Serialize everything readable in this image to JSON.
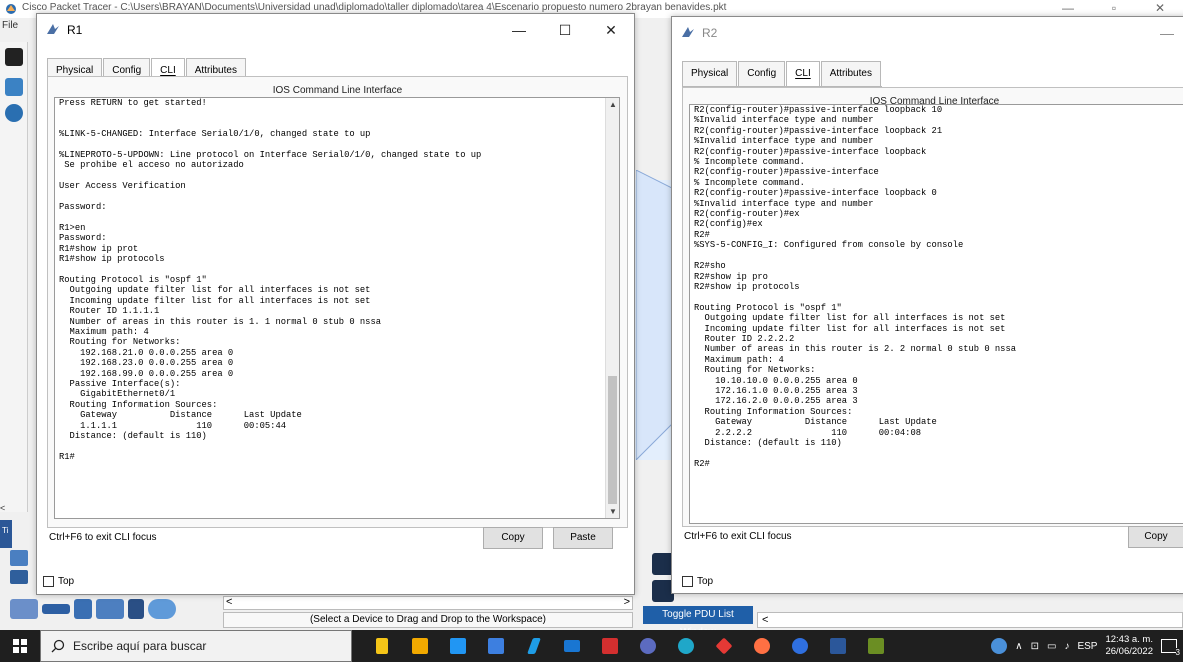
{
  "background_app": {
    "title": "Cisco Packet Tracer - C:\\Users\\BRAYAN\\Documents\\Universidad unad\\diplomado\\taller diplomado\\tarea 4\\Escenario propuesto numero 2brayan benavides.pkt",
    "menu_file": "File",
    "status_text": "(Select a Device to Drag and Drop to the Workspace)",
    "pdu_button": "Toggle PDU List Window",
    "left_strip_label": "Ti"
  },
  "r1_window": {
    "title": "R1",
    "tabs": [
      "Physical",
      "Config",
      "CLI",
      "Attributes"
    ],
    "active_tab": "CLI",
    "header": "IOS Command Line Interface",
    "terminal_lines": [
      "Press RETURN to get started!",
      "",
      "",
      "%LINK-5-CHANGED: Interface Serial0/1/0, changed state to up",
      "",
      "%LINEPROTO-5-UPDOWN: Line protocol on Interface Serial0/1/0, changed state to up",
      " Se prohibe el acceso no autorizado",
      "",
      "User Access Verification",
      "",
      "Password:",
      "",
      "R1>en",
      "Password:",
      "R1#show ip prot",
      "R1#show ip protocols",
      "",
      "Routing Protocol is \"ospf 1\"",
      "  Outgoing update filter list for all interfaces is not set",
      "  Incoming update filter list for all interfaces is not set",
      "  Router ID 1.1.1.1",
      "  Number of areas in this router is 1. 1 normal 0 stub 0 nssa",
      "  Maximum path: 4",
      "  Routing for Networks:",
      "    192.168.21.0 0.0.0.255 area 0",
      "    192.168.23.0 0.0.0.255 area 0",
      "    192.168.99.0 0.0.0.255 area 0",
      "  Passive Interface(s):",
      "    GigabitEthernet0/1",
      "  Routing Information Sources:",
      "    Gateway          Distance      Last Update",
      "    1.1.1.1               110      00:05:44",
      "  Distance: (default is 110)",
      "",
      "R1#"
    ],
    "focus_hint": "Ctrl+F6 to exit CLI focus",
    "copy_label": "Copy",
    "paste_label": "Paste",
    "top_label": "Top"
  },
  "r2_window": {
    "title": "R2",
    "tabs": [
      "Physical",
      "Config",
      "CLI",
      "Attributes"
    ],
    "active_tab": "CLI",
    "header": "IOS Command Line Interface",
    "terminal_lines": [
      "R2(config-router)#passive-interface loopback 10",
      "%Invalid interface type and number",
      "R2(config-router)#passive-interface loopback 21",
      "%Invalid interface type and number",
      "R2(config-router)#passive-interface loopback",
      "% Incomplete command.",
      "R2(config-router)#passive-interface",
      "% Incomplete command.",
      "R2(config-router)#passive-interface loopback 0",
      "%Invalid interface type and number",
      "R2(config-router)#ex",
      "R2(config)#ex",
      "R2#",
      "%SYS-5-CONFIG_I: Configured from console by console",
      "",
      "R2#sho",
      "R2#show ip pro",
      "R2#show ip protocols",
      "",
      "Routing Protocol is \"ospf 1\"",
      "  Outgoing update filter list for all interfaces is not set",
      "  Incoming update filter list for all interfaces is not set",
      "  Router ID 2.2.2.2",
      "  Number of areas in this router is 2. 2 normal 0 stub 0 nssa",
      "  Maximum path: 4",
      "  Routing for Networks:",
      "    10.10.10.0 0.0.0.255 area 0",
      "    172.16.1.0 0.0.0.255 area 3",
      "    172.16.2.0 0.0.0.255 area 3",
      "  Routing Information Sources:",
      "    Gateway          Distance      Last Update",
      "    2.2.2.2               110      00:04:08",
      "  Distance: (default is 110)",
      "",
      "R2#"
    ],
    "focus_hint": "Ctrl+F6 to exit CLI focus",
    "copy_label": "Copy",
    "top_label": "Top"
  },
  "taskbar": {
    "search_placeholder": "Escribe aquí para buscar",
    "language": "ESP",
    "time": "12:43 a. m.",
    "date": "26/06/2022",
    "notification_count": "3"
  }
}
